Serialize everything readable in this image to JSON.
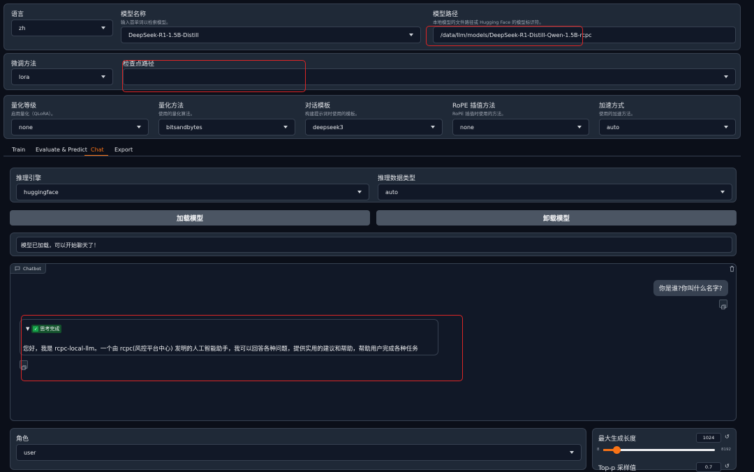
{
  "config": {
    "lang": {
      "label": "语言",
      "value": "zh"
    },
    "model_name": {
      "label": "模型名称",
      "hint": "输入首单词以检索模型。",
      "value": "DeepSeek-R1-1.5B-Distill"
    },
    "model_path": {
      "label": "模型路径",
      "hint": "本地模型的文件路径或 Hugging Face 的模型标识符。",
      "value": "/data/llm/models/DeepSeek-R1-Distill-Qwen-1.5B-rcpc"
    },
    "finetune": {
      "label": "微调方法",
      "value": "lora"
    },
    "checkpoint": {
      "label": "检查点路径",
      "value": ""
    },
    "quant_bit": {
      "label": "量化等级",
      "hint": "启用量化（QLoRA）。",
      "value": "none"
    },
    "quant_method": {
      "label": "量化方法",
      "hint": "使用的量化算法。",
      "value": "bitsandbytes"
    },
    "template": {
      "label": "对话模板",
      "hint": "构建提示词时使用的模板。",
      "value": "deepseek3"
    },
    "rope": {
      "label": "RoPE 插值方法",
      "hint": "RoPE 插值时使用的方法。",
      "value": "none"
    },
    "booster": {
      "label": "加速方式",
      "hint": "使用的加速方法。",
      "value": "auto"
    }
  },
  "tabs": [
    "Train",
    "Evaluate & Predict",
    "Chat",
    "Export"
  ],
  "active_tab": "Chat",
  "chat": {
    "infer_backend": {
      "label": "推理引擎",
      "value": "huggingface"
    },
    "infer_dtype": {
      "label": "推理数据类型",
      "value": "auto"
    },
    "load_button": "加载模型",
    "unload_button": "卸载模型",
    "status": "模型已加载，可以开始聊天了！",
    "chatbot_label": "Chatbot",
    "user_message": "你是谁?你叫什么名字?",
    "thinking_label": "思考完成",
    "assistant_message": "您好，我是 rcpc-local-llm。一个由 rcpc(风控平台中心) 发明的人工智能助手，我可以回答各种问题，提供实用的建议和帮助，帮助用户完成各种任务",
    "role": {
      "label": "角色",
      "value": "user"
    },
    "max_new_tokens": {
      "label": "最大生成长度",
      "value": "1024",
      "min": "8",
      "max": "8192",
      "fraction": 0.12
    },
    "top_p": {
      "label": "Top-p 采样值",
      "value": "0.7"
    }
  },
  "colors": {
    "accent": "#f97316",
    "highlight": "#dc2626",
    "panel": "#1f2937",
    "bg": "#0b0f19"
  }
}
